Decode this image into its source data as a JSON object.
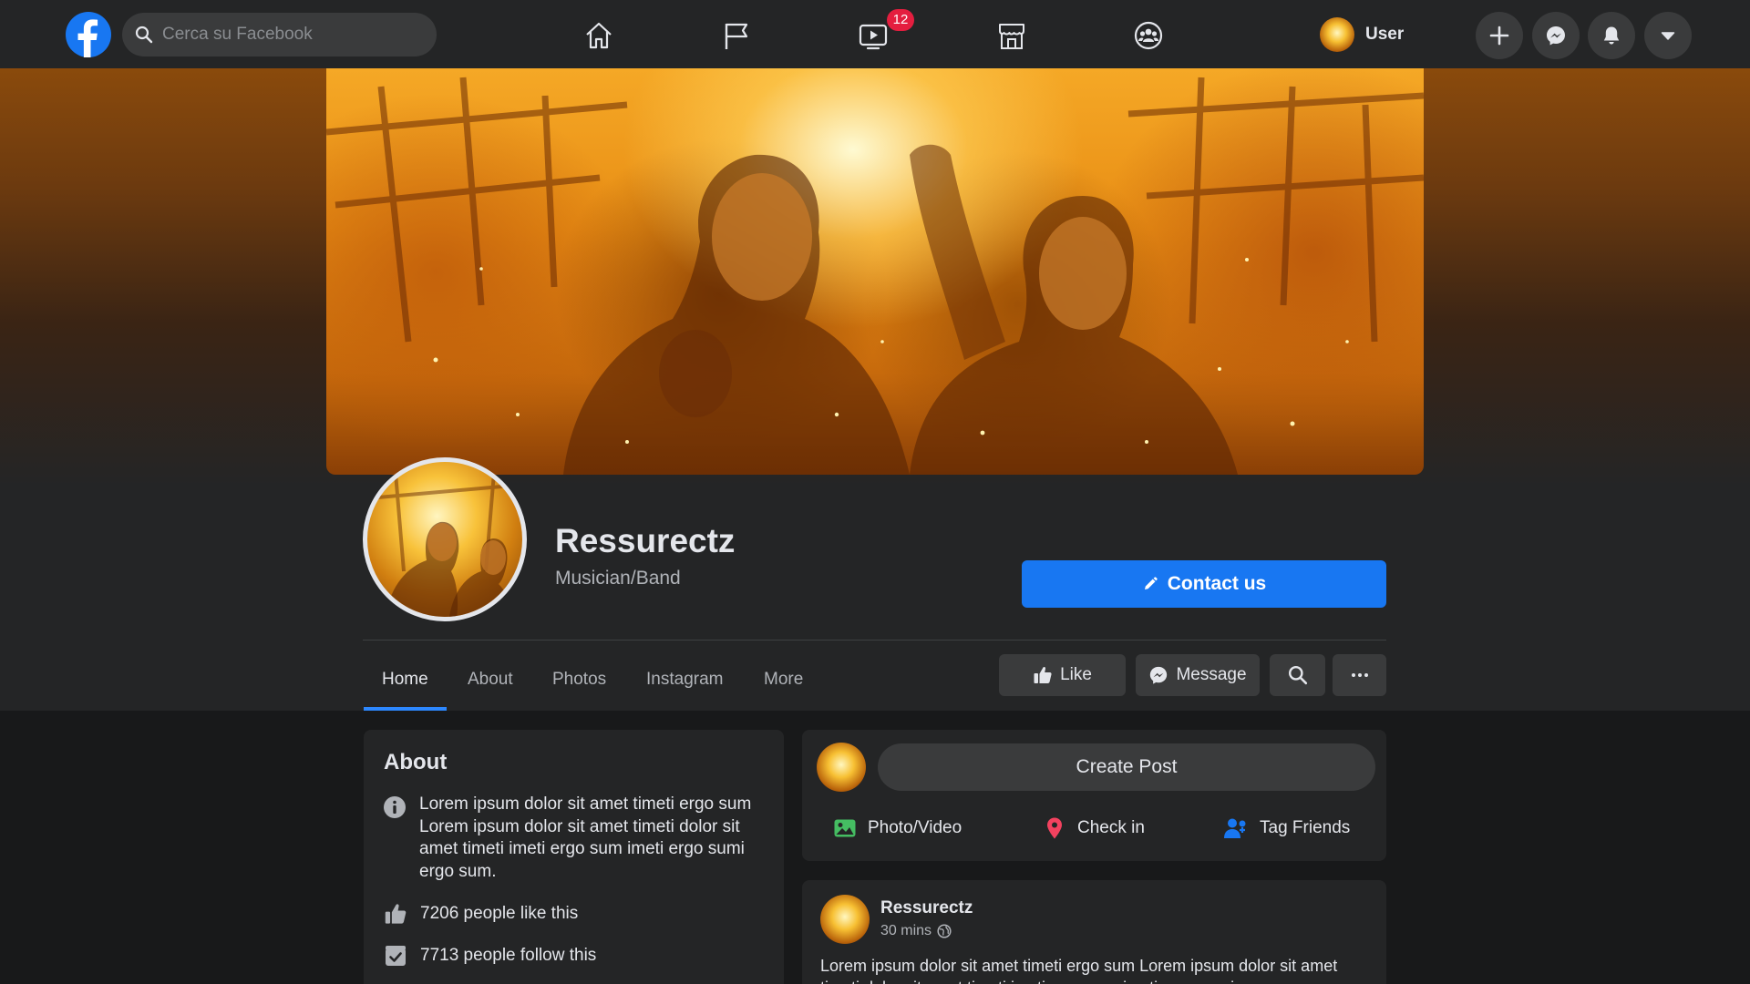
{
  "topbar": {
    "search_placeholder": "Cerca su Facebook",
    "nav_tabs": [
      {
        "name": "home",
        "icon": "home-icon"
      },
      {
        "name": "pages",
        "icon": "flag-icon"
      },
      {
        "name": "watch",
        "icon": "video-icon",
        "badge": "12"
      },
      {
        "name": "marketplace",
        "icon": "store-icon"
      },
      {
        "name": "groups",
        "icon": "groups-icon"
      }
    ],
    "user_name": "User",
    "right_buttons": [
      "plus-icon",
      "messenger-icon",
      "bell-icon",
      "caret-down-icon"
    ]
  },
  "profile": {
    "name": "Ressurectz",
    "category": "Musician/Band",
    "contact_label": "Contact us"
  },
  "tabs": [
    {
      "label": "Home",
      "active": true
    },
    {
      "label": "About",
      "active": false
    },
    {
      "label": "Photos",
      "active": false
    },
    {
      "label": "Instagram",
      "active": false
    },
    {
      "label": "More",
      "active": false
    }
  ],
  "actions": {
    "like_label": "Like",
    "message_label": "Message"
  },
  "about": {
    "title": "About",
    "description": "Lorem ipsum dolor sit amet timeti ergo sum Lorem ipsum dolor sit amet timeti dolor sit amet timeti imeti ergo sum imeti ergo sumi ergo sum.",
    "likes": "7206 people like this",
    "follows": "7713 people follow this"
  },
  "create_post": {
    "button_label": "Create Post",
    "options": [
      "Photo/Video",
      "Check in",
      "Tag Friends"
    ]
  },
  "post": {
    "author": "Ressurectz",
    "time": "30 mins",
    "text": "Lorem ipsum dolor sit amet timeti ergo sum Lorem ipsum dolor sit amet timeti dolor sit amet timeti imeti ergo sum imeti ergo sumi ergo sum."
  },
  "colors": {
    "brand_blue": "#1877f2",
    "tab_active": "#2d88ff",
    "badge_red": "#e41e3f",
    "background": "#18191a",
    "surface": "#242526"
  }
}
